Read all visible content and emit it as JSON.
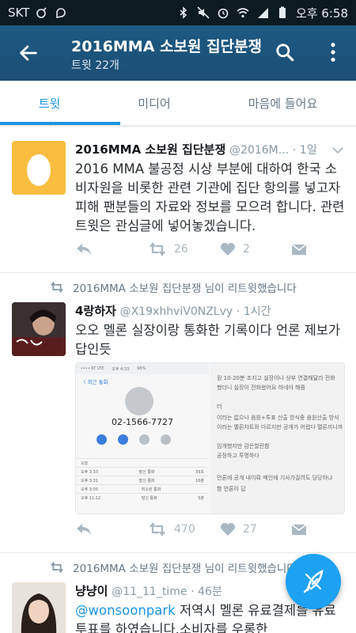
{
  "status_bar": {
    "carrier": "SKT",
    "time": "오후 6:58",
    "icons": [
      "odin-icon",
      "message-icon",
      "bluetooth-icon",
      "mute-icon",
      "alarm-icon",
      "wifi-icon",
      "signal-icon",
      "battery-icon"
    ]
  },
  "app_bar": {
    "title": "2016MMA 소보원 집단분쟁",
    "subtitle": "트윗 22개",
    "icons": [
      "back-arrow-icon",
      "search-icon",
      "more-vert-icon"
    ]
  },
  "tabs": [
    {
      "label": "트윗",
      "active": true
    },
    {
      "label": "미디어",
      "active": false
    },
    {
      "label": "마음에 들어요",
      "active": false
    }
  ],
  "colors": {
    "accent": "#1b95e0",
    "app_bar": "#1b4f72",
    "fab": "#1da1f2"
  },
  "cut_retweet_label": "",
  "tweets": [
    {
      "name": "2016MMA 소보원 집단분쟁",
      "handle": "@2016M...",
      "time": "· 1일",
      "text": "2016 MMA 불공정 시상 부분에 대하여 한국 소비자원을 비롯한 관련 기관에 집단 항의를 넣고자 피해 팬분들의 자료와 정보를 모으려 합니다. 관련트윗은 관심글에 넣어놓겠습니다.",
      "retweets": "26",
      "likes": "2"
    },
    {
      "retweeted_by": "2016MMA 소보원 집단분쟁 님이 리트윗했습니다",
      "name": "4랑하자",
      "handle": "@X19xhhviV0NZLvy",
      "time": "· 1시간",
      "text": "오오 멜론 실장이랑 통화한 기록이다 언론 제보가 답인듯",
      "retweets": "470",
      "likes": "27",
      "media": {
        "phone_number": "02-1566-7727",
        "phone_back": "〈 최근 통화",
        "phone_status_left": "•••• KT LTE",
        "phone_status_time": "오후 4:33",
        "phone_status_right": "96%",
        "phone_avatar_caption": "",
        "phone_section": "오늘",
        "phone_rows": [
          [
            "오후 3:33",
            "발신 통화",
            "39초"
          ],
          [
            "오후 3:31",
            "발신 통화",
            "16분"
          ],
          [
            "오후 3:05",
            "취소된 통화",
            ""
          ],
          [
            "오후 11:12",
            "발신 통화",
            "5분"
          ]
        ],
        "text_lines": [
          "원 10-20분 조지고 실장이나 상부 연결해달라 전화",
          "했더니 실장이 전화왔어요 하네야 해줌",
          "",
          "터",
          "이라는 없으나 음원+투표 산출 방식중 음원산출 방식",
          "이라는 멜론차트와 다르지만 공개가 어렵다 멜론끼니까",
          "",
          "임개했지만 감은할란함",
          "공정하고 투명하다",
          "",
          "언론에 공개 내이뤄 메인에 기사가걸려도 당당하냐",
          "함 언론이 답"
        ]
      }
    },
    {
      "retweeted_by": "2016MMA 소보원 집단분쟁 님이 리트윗했습니다",
      "name": "냥냥이",
      "handle": "@11_11_time",
      "time": "· 46분",
      "mention": "@wonsoonpark",
      "text": " 저역시 멜론 유료결제를 유료투표를 하였습니다.소비자를 우롱한"
    }
  ]
}
